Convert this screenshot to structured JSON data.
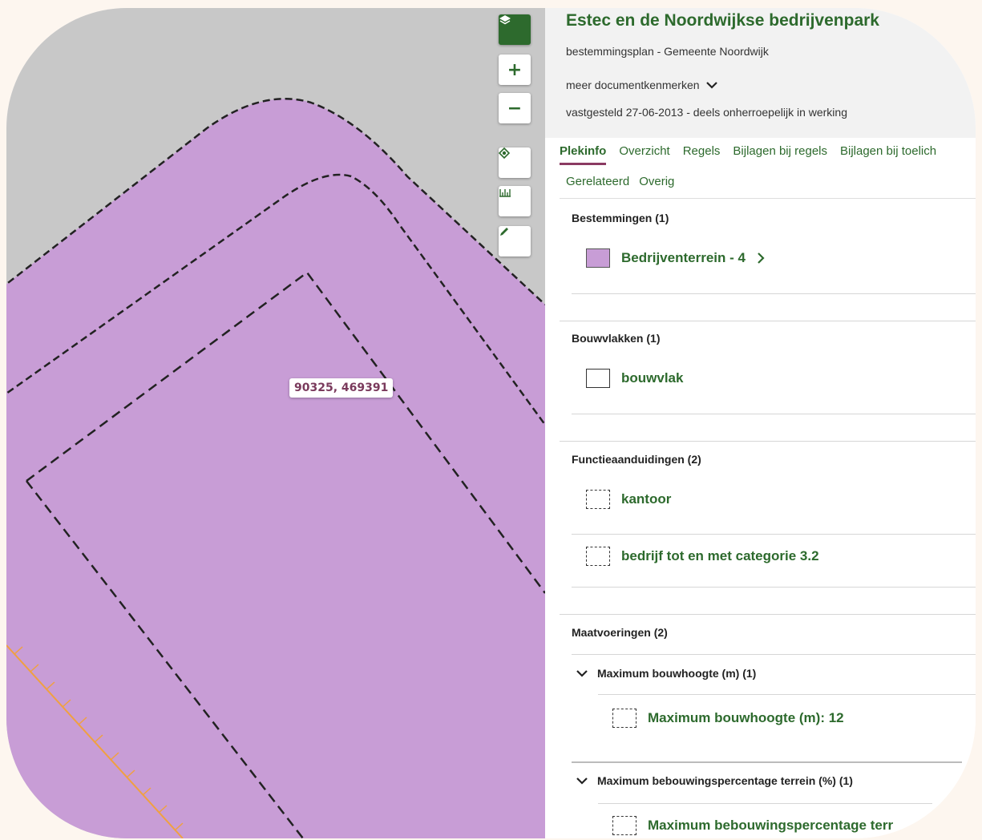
{
  "map": {
    "coordinate_label": "90325, 469391",
    "colors": {
      "zone_fill": "#c89dd6",
      "background": "#c8c8c8",
      "accent": "#2d6a2d",
      "orange_line": "#f0a040"
    },
    "controls": [
      {
        "name": "layers-button",
        "icon": "layers-icon"
      },
      {
        "name": "zoom-in-button",
        "icon": "plus-icon",
        "label": "+"
      },
      {
        "name": "zoom-out-button",
        "icon": "minus-icon",
        "label": "−"
      },
      {
        "name": "locate-button",
        "icon": "locate-icon"
      },
      {
        "name": "measure-button",
        "icon": "ruler-icon"
      },
      {
        "name": "draw-button",
        "icon": "pencil-icon"
      }
    ]
  },
  "document": {
    "title": "Estec en de Noordwijkse bedrijvenpark",
    "subtitle": "bestemmingsplan - Gemeente Noordwijk",
    "more_label": "meer documentkenmerken",
    "status": "vastgesteld 27-06-2013 - deels onherroepelijk in werking"
  },
  "tabs": {
    "row1": [
      "Plekinfo",
      "Overzicht",
      "Regels",
      "Bijlagen bij regels",
      "Bijlagen bij toelich"
    ],
    "row2": [
      "Gerelateerd",
      "Overig"
    ],
    "active": "Plekinfo"
  },
  "sections": {
    "bestemmingen": {
      "title": "Bestemmingen (1)",
      "items": [
        "Bedrijventerrein - 4"
      ]
    },
    "bouwvlakken": {
      "title": "Bouwvlakken (1)",
      "items": [
        "bouwvlak"
      ]
    },
    "functieaanduidingen": {
      "title": "Functieaanduidingen (2)",
      "items": [
        "kantoor",
        "bedrijf tot en met categorie 3.2"
      ]
    },
    "maatvoeringen": {
      "title": "Maatvoeringen (2)",
      "groups": [
        {
          "title": "Maximum bouwhoogte (m) (1)",
          "item": "Maximum bouwhoogte (m): 12"
        },
        {
          "title": "Maximum bebouwingspercentage terrein (%) (1)",
          "item": "Maximum bebouwingspercentage terr"
        }
      ]
    }
  }
}
